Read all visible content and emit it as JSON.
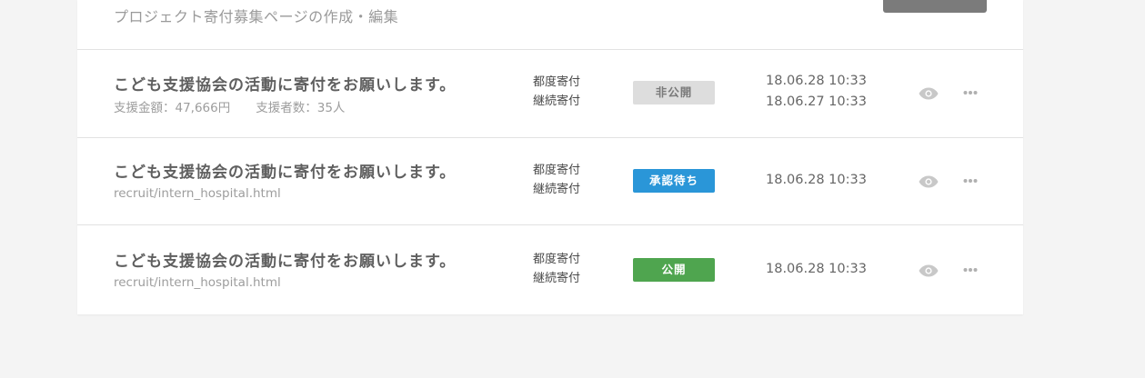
{
  "header": {
    "subtitle": "プロジェクト寄付募集ページの作成・編集"
  },
  "colors": {
    "badge_private": "#dddddd",
    "badge_pending": "#2a96d8",
    "badge_public": "#4fa54f",
    "header_button": "#7b7b7b"
  },
  "rows": [
    {
      "title": "こども支援協会の活動に寄付をお願いします。",
      "amount": "支援金額：47,666円",
      "supporters": "支援者数：35人",
      "type_one_time": "都度寄付",
      "type_recurring": "継続寄付",
      "status": "非公開",
      "date_1": "18.06.28 10:33",
      "date_2": "18.06.27 10:33",
      "preview_icon": "eye-icon",
      "menu_icon": "more-icon"
    },
    {
      "title": "こども支援協会の活動に寄付をお願いします。",
      "url": "recruit/intern_hospital.html",
      "type_one_time": "都度寄付",
      "type_recurring": "継続寄付",
      "status": "承認待ち",
      "date_1": "18.06.28 10:33",
      "preview_icon": "eye-icon",
      "menu_icon": "more-icon"
    },
    {
      "title": "こども支援協会の活動に寄付をお願いします。",
      "url": "recruit/intern_hospital.html",
      "type_one_time": "都度寄付",
      "type_recurring": "継続寄付",
      "status": "公開",
      "date_1": "18.06.28 10:33",
      "preview_icon": "eye-icon",
      "menu_icon": "more-icon"
    }
  ]
}
